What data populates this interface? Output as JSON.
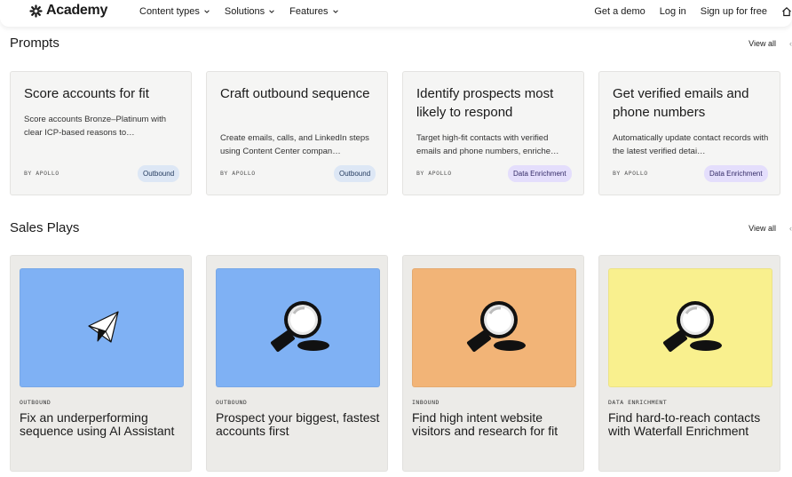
{
  "nav": {
    "logo": "Academy",
    "menu": [
      {
        "label": "Content types"
      },
      {
        "label": "Solutions"
      },
      {
        "label": "Features"
      }
    ],
    "right": [
      {
        "label": "Get a demo"
      },
      {
        "label": "Log in"
      },
      {
        "label": "Sign up for free"
      }
    ]
  },
  "prompts": {
    "title": "Prompts",
    "view_all": "View all",
    "cards": [
      {
        "title": "Score accounts for fit",
        "desc": "Score accounts Bronze–Platinum with clear ICP-based reasons to…",
        "by": "BY APOLLO",
        "badge": "Outbound"
      },
      {
        "title": "Craft outbound sequence",
        "desc": "Create emails, calls, and LinkedIn steps using Content Center compan…",
        "by": "BY APOLLO",
        "badge": "Outbound"
      },
      {
        "title": "Identify prospects most likely to respond",
        "desc": "Target high-fit contacts with verified emails and phone numbers, enriche…",
        "by": "BY APOLLO",
        "badge": "Data Enrichment"
      },
      {
        "title": "Get verified emails and phone numbers",
        "desc": "Automatically update contact records with the latest verified detai…",
        "by": "BY APOLLO",
        "badge": "Data Enrichment"
      }
    ]
  },
  "sales_plays": {
    "title": "Sales Plays",
    "view_all": "View all",
    "cards": [
      {
        "tag": "OUTBOUND",
        "title": "Fix an underperforming sequence using AI Assistant",
        "image_color": "#7fb1f4",
        "icon": "paper-plane-icon"
      },
      {
        "tag": "OUTBOUND",
        "title": "Prospect your biggest, fastest accounts first",
        "image_color": "#7fb1f4",
        "icon": "magnifier-icon"
      },
      {
        "tag": "INBOUND",
        "title": "Find high intent website visitors and research for fit",
        "image_color": "#f2b477",
        "icon": "magnifier-icon"
      },
      {
        "tag": "DATA ENRICHMENT",
        "title": "Find hard-to-reach contacts with Waterfall Enrichment",
        "image_color": "#f9f08e",
        "icon": "magnifier-icon"
      }
    ]
  },
  "colors": {
    "badge_outbound": "#dde7f5",
    "badge_data": "#e4defc",
    "card_bg": "#f5f5f4",
    "play_bg": "#ecebe8"
  }
}
